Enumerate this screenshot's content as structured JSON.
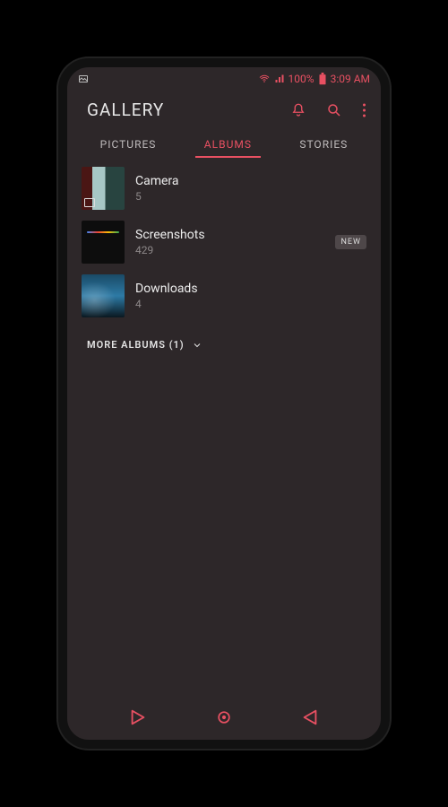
{
  "accent": "#e85062",
  "statusbar": {
    "wifi_label": "wifi",
    "signal_label": "signal",
    "battery_pct": "100%",
    "time": "3:09 AM"
  },
  "header": {
    "title": "GALLERY"
  },
  "tabs": {
    "pictures": "PICTURES",
    "albums": "ALBUMS",
    "stories": "STORIES",
    "active": "albums"
  },
  "albums": [
    {
      "name": "Camera",
      "count": "5",
      "thumb": "camera",
      "badge": ""
    },
    {
      "name": "Screenshots",
      "count": "429",
      "thumb": "screenshots",
      "badge": "NEW"
    },
    {
      "name": "Downloads",
      "count": "4",
      "thumb": "downloads",
      "badge": ""
    }
  ],
  "more_albums": {
    "label": "MORE ALBUMS (1)"
  },
  "nav": {
    "recent": "recent",
    "home": "home",
    "back": "back"
  }
}
